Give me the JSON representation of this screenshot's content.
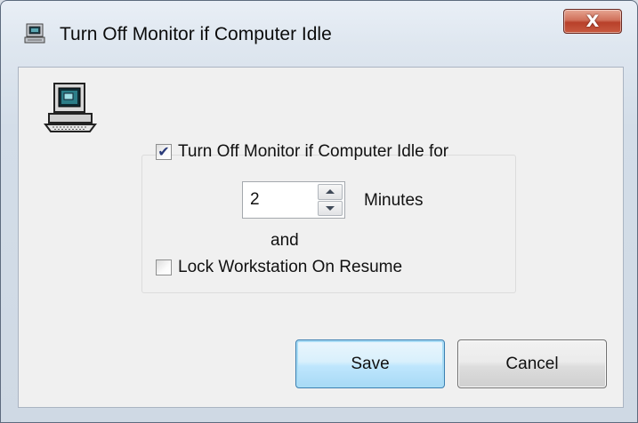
{
  "window": {
    "title": "Turn Off Monitor if Computer Idle",
    "title_icon": "monitor-icon",
    "close_label": "X",
    "close_icon": "close-icon"
  },
  "app_icon": "computer-icon",
  "options": {
    "turn_off_checkbox": {
      "label": "Turn Off Monitor if Computer Idle for",
      "checked": true
    },
    "idle_minutes": {
      "value": "2",
      "unit_label": "Minutes"
    },
    "and_label": "and",
    "lock_checkbox": {
      "label": "Lock Workstation On Resume",
      "checked": false
    }
  },
  "buttons": {
    "save": "Save",
    "cancel": "Cancel"
  },
  "colors": {
    "close_button": "#c85a40",
    "default_button_border": "#3c7fb1"
  }
}
